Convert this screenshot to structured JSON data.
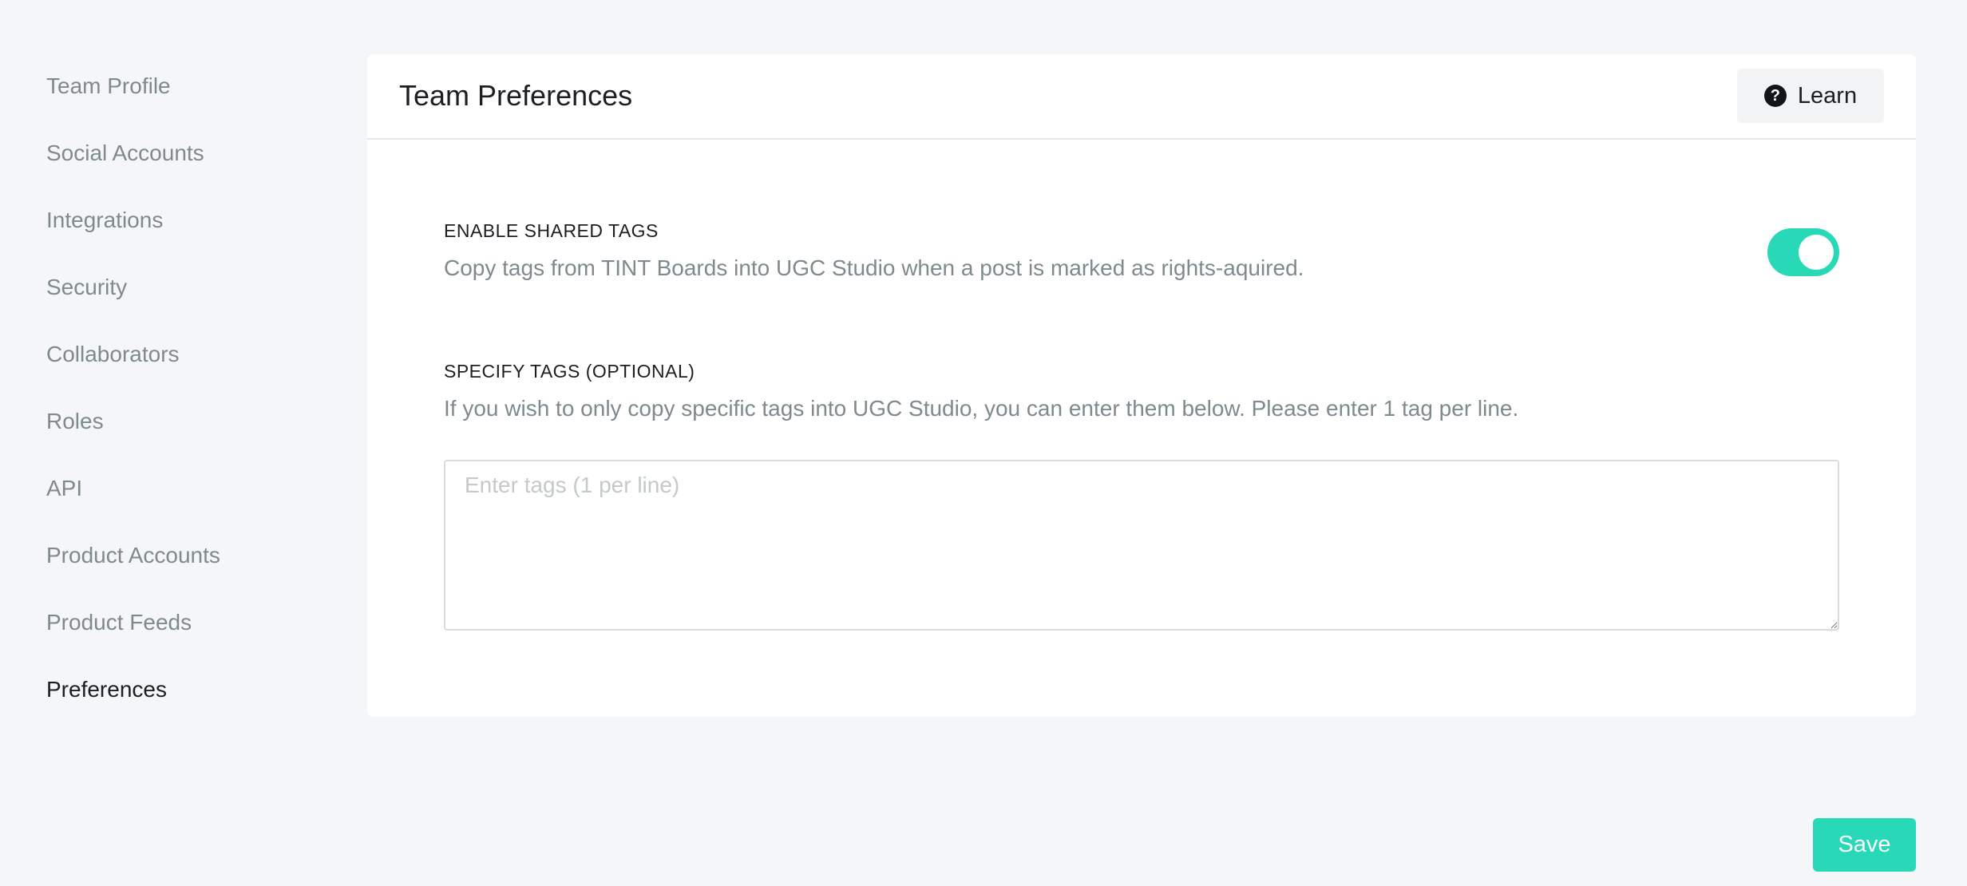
{
  "sidebar": {
    "items": [
      {
        "label": "Team Profile"
      },
      {
        "label": "Social Accounts"
      },
      {
        "label": "Integrations"
      },
      {
        "label": "Security"
      },
      {
        "label": "Collaborators"
      },
      {
        "label": "Roles"
      },
      {
        "label": "API"
      },
      {
        "label": "Product Accounts"
      },
      {
        "label": "Product Feeds"
      },
      {
        "label": "Preferences",
        "active": true
      }
    ]
  },
  "header": {
    "title": "Team Preferences",
    "learn_label": "Learn",
    "learn_icon": "question-circle-icon"
  },
  "shared_tags": {
    "heading": "ENABLE SHARED TAGS",
    "description": "Copy tags from TINT Boards into UGC Studio when a post is marked as rights-aquired.",
    "enabled": true
  },
  "specify_tags": {
    "heading": "SPECIFY TAGS (OPTIONAL)",
    "description": "If you wish to only copy specific tags into UGC Studio, you can enter them below. Please enter 1 tag per line.",
    "value": "",
    "placeholder": "Enter tags (1 per line)"
  },
  "footer": {
    "save_label": "Save"
  },
  "colors": {
    "accent": "#27d9b6",
    "background": "#f5f6f7",
    "muted_text": "#7f8a8e",
    "primary_text": "#1b1f24"
  }
}
